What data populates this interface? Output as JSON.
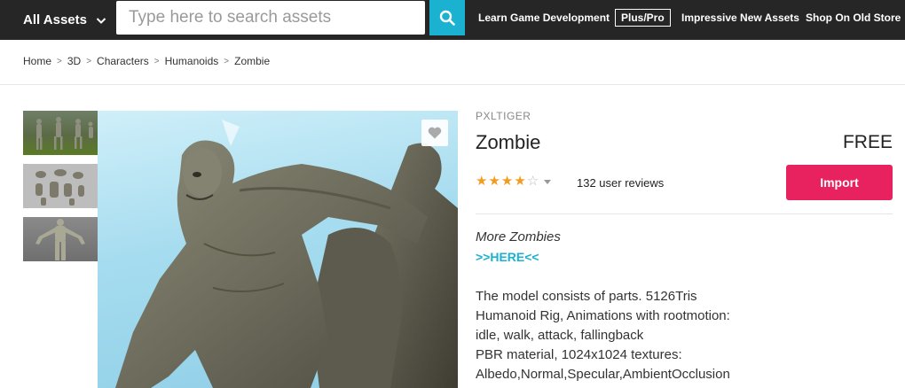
{
  "topbar": {
    "category_label": "All Assets",
    "search_placeholder": "Type here to search assets",
    "nav": {
      "learn": "Learn Game Development",
      "pluspro": "Plus/Pro",
      "new_assets": "Impressive New Assets",
      "old_store": "Shop On Old Store"
    }
  },
  "breadcrumb": [
    "Home",
    "3D",
    "Characters",
    "Humanoids",
    "Zombie"
  ],
  "product": {
    "publisher": "PXLTIGER",
    "title": "Zombie",
    "price": "FREE",
    "rating": 4,
    "rating_max": 5,
    "reviews": "132 user reviews",
    "import_label": "Import",
    "more_label": "More Zombies",
    "here_link": ">>HERE<<",
    "description": [
      "The model consists of parts. 5126Tris",
      "Humanoid Rig, Animations with rootmotion:",
      "idle, walk, attack, fallingback",
      "PBR material, 1024x1024 textures:",
      "Albedo,Normal,Specular,AmbientOcclusion"
    ]
  },
  "icons": {
    "category": "chevron-down-icon",
    "search": "search-icon",
    "favorite": "heart-icon",
    "rating_menu": "caret-down-icon"
  },
  "colors": {
    "topbar": "#262626",
    "search_button": "#1bb1d0",
    "import_button": "#e8225f",
    "star": "#f29c1f",
    "link": "#1bb1d0"
  }
}
